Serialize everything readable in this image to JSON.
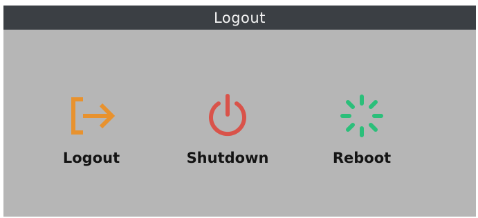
{
  "dialog": {
    "title": "Logout"
  },
  "options": [
    {
      "label": "Logout",
      "icon": "logout-icon",
      "color": "#e8922e"
    },
    {
      "label": "Shutdown",
      "icon": "power-icon",
      "color": "#d9534a"
    },
    {
      "label": "Reboot",
      "icon": "reboot-spinner-icon",
      "color": "#2bbf7a"
    }
  ],
  "colors": {
    "title_bar": "#3b3f44",
    "background": "#b6b6b6",
    "label_text": "#141414"
  }
}
